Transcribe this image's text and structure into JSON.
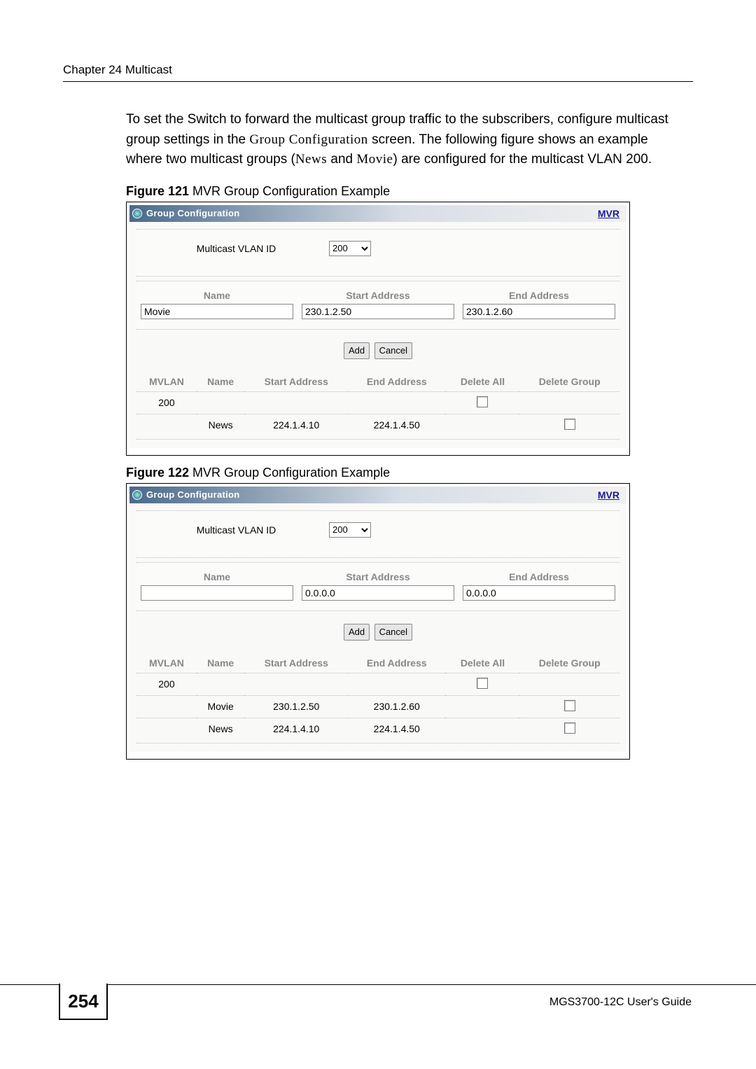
{
  "chapter_header": "Chapter 24 Multicast",
  "body_paragraph": "To set the Switch to forward the multicast group traffic to the subscribers, configure multicast group settings in the Group Configuration screen. The following figure shows an example where two multicast groups (News and Movie) are configured for the multicast VLAN 200.",
  "fig121": {
    "caption_bold": "Figure 121",
    "caption_rest": "   MVR Group Configuration Example",
    "panel_title": "Group Configuration",
    "mvr_link": "MVR",
    "mvid_label": "Multicast VLAN ID",
    "mvid_value": "200",
    "headers": {
      "name": "Name",
      "start": "Start Address",
      "end": "End Address"
    },
    "inputs": {
      "name": "Movie",
      "start": "230.1.2.50",
      "end": "230.1.2.60"
    },
    "btn_add": "Add",
    "btn_cancel": "Cancel",
    "tbl_headers": [
      "MVLAN",
      "Name",
      "Start Address",
      "End Address",
      "Delete All",
      "Delete Group"
    ],
    "rows": [
      {
        "mvlan": "200",
        "name": "",
        "start": "",
        "end": "",
        "delall": true,
        "delgrp": false
      },
      {
        "mvlan": "",
        "name": "News",
        "start": "224.1.4.10",
        "end": "224.1.4.50",
        "delall": false,
        "delgrp": true
      }
    ]
  },
  "fig122": {
    "caption_bold": "Figure 122",
    "caption_rest": "   MVR Group Configuration Example",
    "panel_title": "Group Configuration",
    "mvr_link": "MVR",
    "mvid_label": "Multicast VLAN ID",
    "mvid_value": "200",
    "headers": {
      "name": "Name",
      "start": "Start Address",
      "end": "End Address"
    },
    "inputs": {
      "name": "",
      "start": "0.0.0.0",
      "end": "0.0.0.0"
    },
    "btn_add": "Add",
    "btn_cancel": "Cancel",
    "tbl_headers": [
      "MVLAN",
      "Name",
      "Start Address",
      "End Address",
      "Delete All",
      "Delete Group"
    ],
    "rows": [
      {
        "mvlan": "200",
        "name": "",
        "start": "",
        "end": "",
        "delall": true,
        "delgrp": false
      },
      {
        "mvlan": "",
        "name": "Movie",
        "start": "230.1.2.50",
        "end": "230.1.2.60",
        "delall": false,
        "delgrp": true
      },
      {
        "mvlan": "",
        "name": "News",
        "start": "224.1.4.10",
        "end": "224.1.4.50",
        "delall": false,
        "delgrp": true
      }
    ]
  },
  "footer": {
    "page_num": "254",
    "guide": "MGS3700-12C User's Guide"
  }
}
